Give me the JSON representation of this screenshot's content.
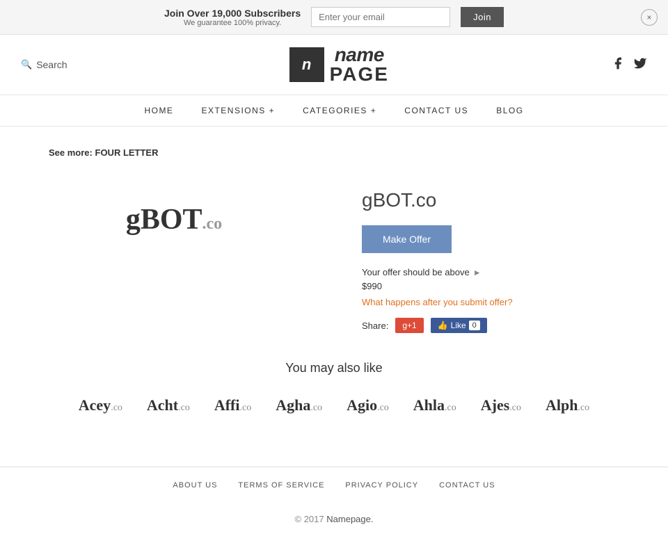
{
  "banner": {
    "headline": "Join Over 19,000 Subscribers",
    "subtext": "We guarantee 100% privacy.",
    "email_placeholder": "Enter your email",
    "join_label": "Join",
    "close_symbol": "×"
  },
  "header": {
    "search_label": "Search",
    "logo_icon": "n",
    "logo_name": "name",
    "logo_page": "PAGE",
    "facebook_icon": "f",
    "twitter_icon": "t"
  },
  "nav": {
    "items": [
      {
        "label": "HOME",
        "id": "home"
      },
      {
        "label": "EXTENSIONS +",
        "id": "extensions"
      },
      {
        "label": "CATEGORIES +",
        "id": "categories"
      },
      {
        "label": "CONTACT  US",
        "id": "contact"
      },
      {
        "label": "BLOG",
        "id": "blog"
      }
    ]
  },
  "breadcrumb": {
    "prefix": "See more:",
    "link_text": "FOUR LETTER"
  },
  "domain": {
    "name": "gBOT",
    "tld": ".co",
    "full": "gBOT.co",
    "make_offer_label": "Make Offer",
    "offer_info": "Your offer should be above",
    "offer_amount": "$990",
    "offer_link": "What happens after you submit offer?",
    "share_label": "Share:",
    "gplus_label": "g+1",
    "fb_label": "Like",
    "fb_count": "0"
  },
  "also_like": {
    "title": "You may also like",
    "domains": [
      {
        "name": "Acey",
        "tld": ".co"
      },
      {
        "name": "Acht",
        "tld": ".co"
      },
      {
        "name": "Affi",
        "tld": ".co"
      },
      {
        "name": "Agha",
        "tld": ".co"
      },
      {
        "name": "Agio",
        "tld": ".co"
      },
      {
        "name": "Ahla",
        "tld": ".co"
      },
      {
        "name": "Ajes",
        "tld": ".co"
      },
      {
        "name": "Alph",
        "tld": ".co"
      }
    ]
  },
  "footer": {
    "links": [
      {
        "label": "ABOUT  US",
        "id": "about"
      },
      {
        "label": "TERMS  OF  SERVICE",
        "id": "tos"
      },
      {
        "label": "PRIVACY  POLICY",
        "id": "privacy"
      },
      {
        "label": "CONTACT  US",
        "id": "contact"
      }
    ],
    "copyright": "© 2017",
    "brand": "Namepage.",
    "period": ""
  }
}
